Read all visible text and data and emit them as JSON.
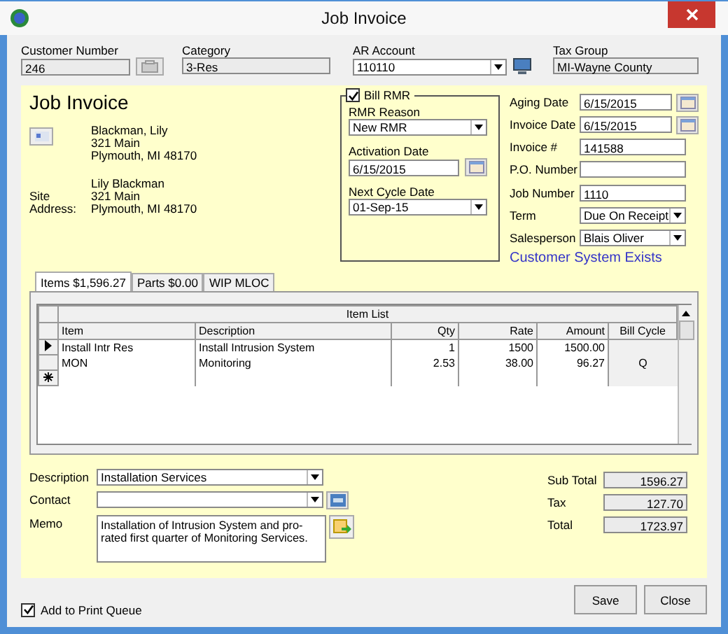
{
  "window": {
    "title": "Job Invoice"
  },
  "header": [
    {
      "label": "Customer Number",
      "value": "246",
      "kind": "text-button"
    },
    {
      "label": "Category",
      "value": "3-Res",
      "kind": "readonly"
    },
    {
      "label": "AR Account",
      "value": "110110",
      "kind": "select-button"
    },
    {
      "label": "Tax Group",
      "value": "MI-Wayne County",
      "kind": "readonly"
    }
  ],
  "heading": "Job Invoice",
  "customer": {
    "lines": [
      "Blackman, Lily",
      "321 Main",
      "Plymouth, MI  48170"
    ]
  },
  "site": {
    "label": "Site Address:",
    "lines": [
      "Lily Blackman",
      "321 Main",
      "Plymouth, MI  48170"
    ]
  },
  "rmr": {
    "bill_rmr": {
      "label": "Bill RMR",
      "checked": true
    },
    "fields": [
      {
        "label": "RMR Reason",
        "value": "New RMR",
        "kind": "select"
      },
      {
        "label": "Activation Date",
        "value": "6/15/2015",
        "kind": "date"
      },
      {
        "label": "Next Cycle Date",
        "value": "01-Sep-15",
        "kind": "select"
      }
    ]
  },
  "details": [
    {
      "label": "Aging Date",
      "value": "6/15/2015",
      "kind": "date"
    },
    {
      "label": "Invoice Date",
      "value": "6/15/2015",
      "kind": "date"
    },
    {
      "label": "Invoice #",
      "value": "141588",
      "kind": "text"
    },
    {
      "label": "P.O. Number",
      "kind": "text"
    },
    {
      "label": "Job Number",
      "value": "1110",
      "kind": "text"
    },
    {
      "label": "Term",
      "value": "Due On Receipt",
      "kind": "select"
    },
    {
      "label": "Salesperson",
      "value": "Blais Oliver",
      "kind": "select"
    }
  ],
  "customer_system_link": "Customer System Exists",
  "tabs": [
    {
      "label": "Items  $1,596.27",
      "selected": true
    },
    {
      "label": "Parts  $0.00",
      "selected": false
    },
    {
      "label": "WIP MLOC",
      "selected": false
    }
  ],
  "table": {
    "title": "Item List",
    "columns": [
      "Item",
      "Description",
      "Qty",
      "Rate",
      "Amount",
      "Bill Cycle"
    ],
    "rows": [
      {
        "cells": [
          "Install Intr Res",
          "Install Intrusion System",
          "1",
          "1500",
          "1500.00"
        ],
        "current": true
      },
      {
        "cells": [
          "MON",
          "Monitoring",
          "2.53",
          "38.00",
          "96.27",
          "Q"
        ],
        "current": false
      }
    ]
  },
  "description": {
    "label": "Description",
    "value": "Installation Services"
  },
  "contact": {
    "label": "Contact"
  },
  "memo": {
    "label": "Memo",
    "value": "Installation of Intrusion System and pro-rated first quarter of Monitoring Services."
  },
  "totals": [
    {
      "label": "Sub Total",
      "value": "1596.27"
    },
    {
      "label": "Tax",
      "value": "127.70"
    },
    {
      "label": "Total",
      "value": "1723.97"
    }
  ],
  "print_queue": {
    "label": "Add to Print Queue",
    "checked": true
  },
  "buttons": [
    "Save",
    "Close"
  ]
}
